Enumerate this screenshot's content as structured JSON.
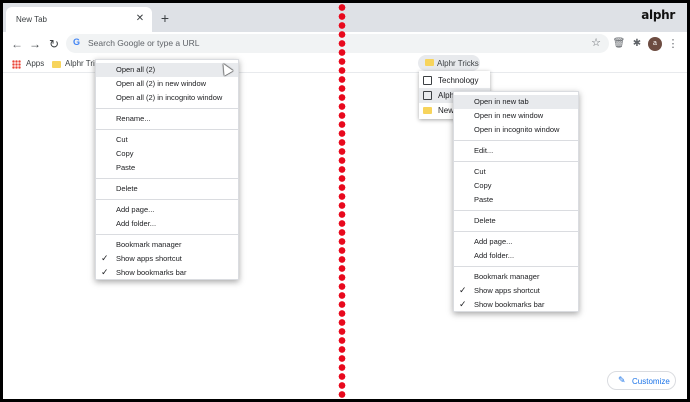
{
  "tab": {
    "title": "New Tab",
    "close": "✕"
  },
  "new_tab": "+",
  "logo": "alphr",
  "toolbar": {
    "back": "←",
    "forward": "→",
    "reload": "↻",
    "g": "G",
    "omnibox_placeholder": "Search Google or type a URL",
    "star": "☆",
    "trash": "🗑",
    "puzzle": "✱",
    "avatar": "a",
    "more": "⋮"
  },
  "bookmarks": {
    "apps_label": "Apps",
    "folder_label": "Alphr Tricks",
    "folder_truncated": "Alphr Tric"
  },
  "dropdown": {
    "items": [
      "Technology",
      "Alph",
      "New"
    ]
  },
  "left_menu": {
    "items": [
      "Open all (2)",
      "Open all (2) in new window",
      "Open all (2) in incognito window",
      "Rename...",
      "Cut",
      "Copy",
      "Paste",
      "Delete",
      "Add page...",
      "Add folder...",
      "Bookmark manager",
      "Show apps shortcut",
      "Show bookmarks bar"
    ]
  },
  "right_menu": {
    "items": [
      "Open in new tab",
      "Open in new window",
      "Open in incognito window",
      "Edit...",
      "Cut",
      "Copy",
      "Paste",
      "Delete",
      "Add page...",
      "Add folder...",
      "Bookmark manager",
      "Show apps shortcut",
      "Show bookmarks bar"
    ]
  },
  "check": "✓",
  "customize": {
    "icon": "✎",
    "label": "Customize"
  }
}
